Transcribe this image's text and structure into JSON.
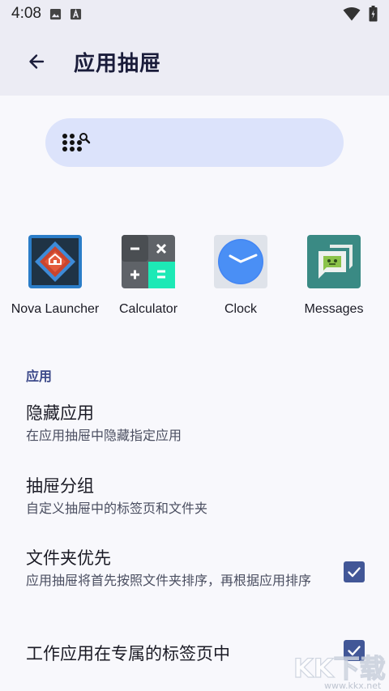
{
  "status_bar": {
    "time": "4:08",
    "icons": [
      "image-icon",
      "font-a-icon",
      "wifi-icon",
      "battery-icon"
    ]
  },
  "app_bar": {
    "title": "应用抽屉",
    "back_icon": "arrow-back-icon"
  },
  "search": {
    "icon": "dots-search-icon"
  },
  "apps": [
    {
      "label": "Nova Launcher",
      "icon": "nova-launcher-icon"
    },
    {
      "label": "Calculator",
      "icon": "calculator-icon"
    },
    {
      "label": "Clock",
      "icon": "clock-icon"
    },
    {
      "label": "Messages",
      "icon": "messages-icon"
    }
  ],
  "section": {
    "header": "应用"
  },
  "preferences": [
    {
      "title": "隐藏应用",
      "subtitle": "在应用抽屉中隐藏指定应用"
    },
    {
      "title": "抽屉分组",
      "subtitle": "自定义抽屉中的标签页和文件夹"
    },
    {
      "title": "文件夹优先",
      "subtitle": "应用抽屉将首先按照文件夹排序，再根据应用排序",
      "checked": true
    },
    {
      "title": "工作应用在专属的标签页中",
      "checked": true
    }
  ],
  "watermark": {
    "text": "KK下载",
    "url_text": "www.kkx.net"
  },
  "colors": {
    "app_bar_bg": "#ececf4",
    "search_bg": "#dce3fb",
    "accent": "#425797",
    "section_header": "#3d4a8a"
  }
}
